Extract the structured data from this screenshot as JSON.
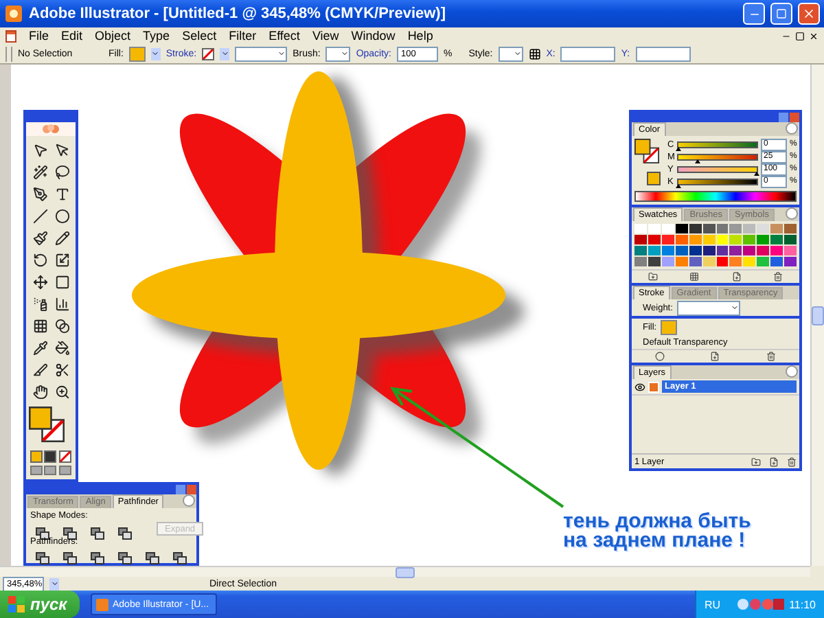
{
  "window": {
    "title": "Adobe Illustrator - [Untitled-1 @ 345,48% (CMYK/Preview)]"
  },
  "menu": [
    "File",
    "Edit",
    "Object",
    "Type",
    "Select",
    "Filter",
    "Effect",
    "View",
    "Window",
    "Help"
  ],
  "control_bar": {
    "selection": "No Selection",
    "fill_label": "Fill:",
    "stroke_label": "Stroke:",
    "brush_label": "Brush:",
    "opacity_label": "Opacity:",
    "opacity_value": "100",
    "opacity_unit": "%",
    "style_label": "Style:",
    "x_label": "X:",
    "y_label": "Y:"
  },
  "color_panel": {
    "tab": "Color",
    "channels": [
      {
        "name": "C",
        "level": 0,
        "value": "0",
        "unit": "%"
      },
      {
        "name": "M",
        "level": 0.25,
        "value": "25",
        "unit": "%"
      },
      {
        "name": "Y",
        "level": 1,
        "value": "100",
        "unit": "%"
      },
      {
        "name": "K",
        "level": 0,
        "value": "0",
        "unit": "%"
      }
    ]
  },
  "swatches_panel": {
    "tabs": [
      {
        "label": "Swatches",
        "selected": true
      },
      {
        "label": "Brushes",
        "selected": false
      },
      {
        "label": "Symbols",
        "selected": false
      }
    ]
  },
  "stroke_panel": {
    "tabs": [
      {
        "label": "Stroke",
        "selected": true
      },
      {
        "label": "Gradient",
        "selected": false
      },
      {
        "label": "Transparency",
        "selected": false
      }
    ],
    "weight_label": "Weight:"
  },
  "appearance_panel": {
    "fill_label": "Fill:",
    "transparency": "Default Transparency"
  },
  "layers_panel": {
    "tab": "Layers",
    "layers": [
      {
        "name": "Layer 1",
        "selected": true
      }
    ],
    "count": "1 Layer"
  },
  "pathfinder_panel": {
    "tabs": [
      {
        "label": "Transform",
        "selected": false
      },
      {
        "label": "Align",
        "selected": false
      },
      {
        "label": "Pathfinder",
        "selected": true
      }
    ],
    "shape_modes_label": "Shape Modes:",
    "expand_button": {
      "label": "Expand",
      "disabled": true
    },
    "pathfinders_label": "Pathfinders:"
  },
  "annotation": [
    "тень должна быть",
    "на заднем плане !"
  ],
  "status_bar": {
    "zoom": "345,48%",
    "tool": "Direct Selection"
  },
  "taskbar": {
    "start": "пуск",
    "tasks": [
      "Adobe Illustrator - [U..."
    ],
    "language": "RU",
    "clock": "11:10"
  }
}
